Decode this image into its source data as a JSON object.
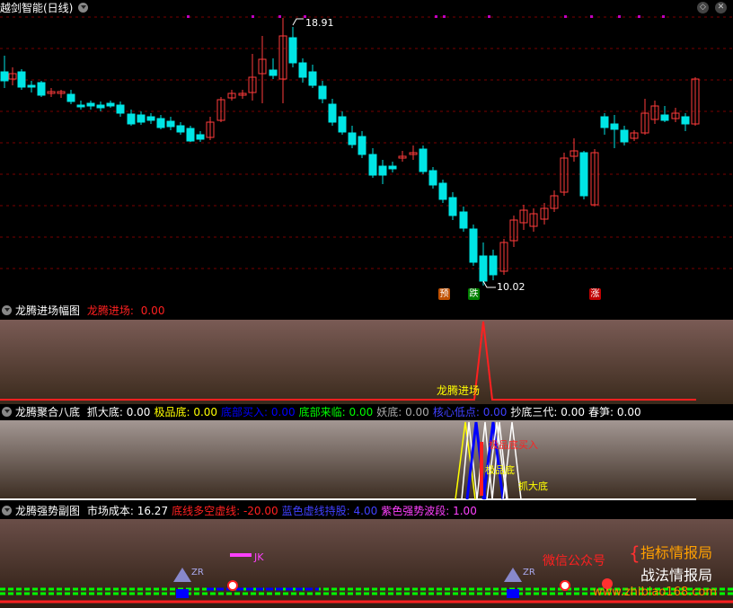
{
  "main": {
    "title": "越剑智能(日线)",
    "high_label": "18.91",
    "low_label": "10.02",
    "tag_yu": "预",
    "tag_die": "跌",
    "tag_zhang": "涨",
    "colors": {
      "up": "#ff3b3b",
      "down": "#00e5e5",
      "grid": "#7a0000",
      "dot": "#c000c0"
    }
  },
  "panel1": {
    "title": "龙腾进场幅图",
    "indicator_name": "龙腾进场",
    "indicator_value": "0.00",
    "annotation": "龙腾进场"
  },
  "panel2": {
    "title": "龙腾聚合八底",
    "items": [
      {
        "name": "抓大底",
        "value": "0.00",
        "color": "#ffffff"
      },
      {
        "name": "极品底",
        "value": "0.00",
        "color": "#ffff00"
      },
      {
        "name": "底部买入",
        "value": "0.00",
        "color": "#0000ff"
      },
      {
        "name": "底部来临",
        "value": "0.00",
        "color": "#00ff00"
      },
      {
        "name": "妖底",
        "value": "0.00",
        "color": "#aaaaaa"
      },
      {
        "name": "核心低点",
        "value": "0.00",
        "color": "#4040ff"
      },
      {
        "name": "抄底三代",
        "value": "0.00",
        "color": "#ffffff"
      },
      {
        "name": "春笋",
        "value": "0.00",
        "color": "#ffffff"
      }
    ],
    "labels": [
      "极品底买入",
      "极品底",
      "抓大底"
    ]
  },
  "panel3": {
    "title": "龙腾强势副图",
    "items": [
      {
        "name": "市场成本",
        "value": "16.27",
        "color": "#ffffff"
      },
      {
        "name": "底线多空虚线",
        "value": "-20.00",
        "color": "#ff2020"
      },
      {
        "name": "蓝色虚线持股",
        "value": "4.00",
        "color": "#4040ff"
      },
      {
        "name": "紫色强势波段",
        "value": "1.00",
        "color": "#ff40ff"
      }
    ],
    "jk_label": "JK",
    "zr_label": "ZR",
    "watermark": "微信公众号",
    "brand_line1": "指标情报局",
    "brand_line2": "战法情报局",
    "site": "www.zhibiao168.com"
  }
}
